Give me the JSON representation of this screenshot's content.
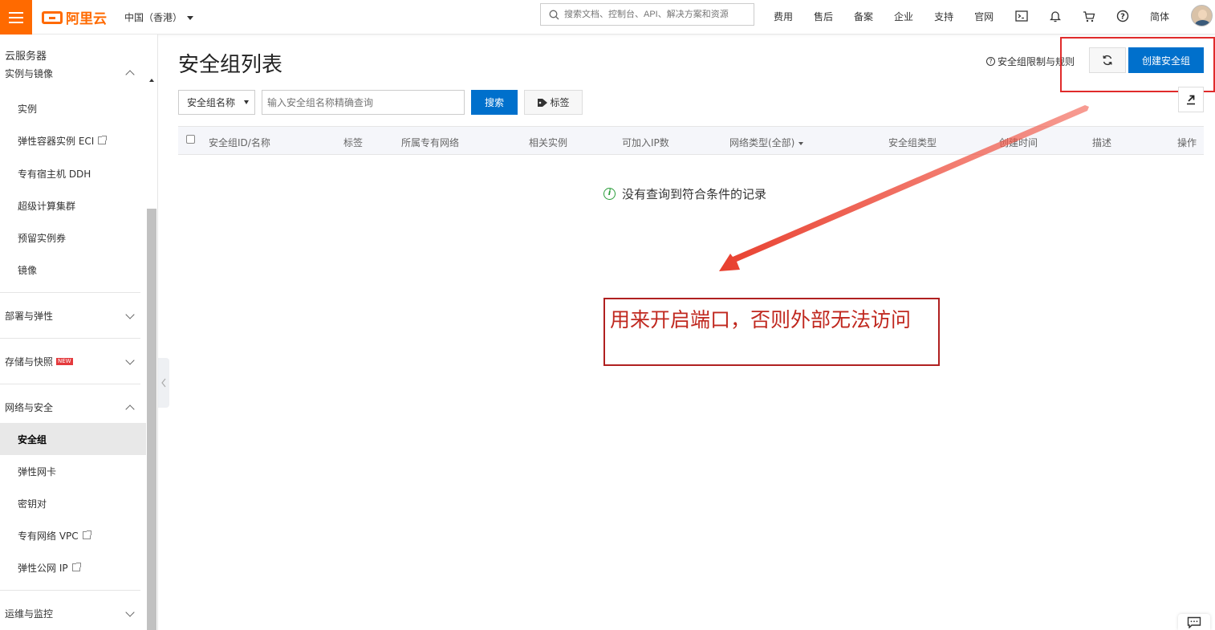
{
  "topbar": {
    "brand": "阿里云",
    "region": "中国（香港）",
    "search_placeholder": "搜索文档、控制台、API、解决方案和资源",
    "nav": [
      "费用",
      "售后",
      "备案",
      "企业",
      "支持",
      "官网"
    ],
    "lang": "简体"
  },
  "sidebar": {
    "title": "云服务器",
    "groups": {
      "instances": "实例与镜像",
      "deploy": "部署与弹性",
      "storage": "存储与快照",
      "storage_badge": "NEW",
      "network": "网络与安全",
      "ops": "运维与监控"
    },
    "instance_items": [
      "实例",
      "弹性容器实例 ECI",
      "专有宿主机 DDH",
      "超级计算集群",
      "预留实例券",
      "镜像"
    ],
    "network_items": [
      "安全组",
      "弹性网卡",
      "密钥对",
      "专有网络 VPC",
      "弹性公网 IP"
    ]
  },
  "main": {
    "title": "安全组列表",
    "help_link": "安全组限制与规则",
    "create_button": "创建安全组",
    "filter_select": "安全组名称",
    "filter_placeholder": "输入安全组名称精确查询",
    "search_button": "搜索",
    "tag_button": "标签",
    "columns": [
      "安全组ID/名称",
      "标签",
      "所属专有网络",
      "相关实例",
      "可加入IP数",
      "网络类型(全部)",
      "安全组类型",
      "创建时间",
      "描述",
      "操作"
    ],
    "empty_message": "没有查询到符合条件的记录"
  },
  "annotation": {
    "text": "用来开启端口，否则外部无法访问",
    "color": "#c0281f"
  },
  "colors": {
    "accent": "#ff6a00",
    "primary": "#0070cc",
    "annotation_red": "#e02b2b"
  }
}
